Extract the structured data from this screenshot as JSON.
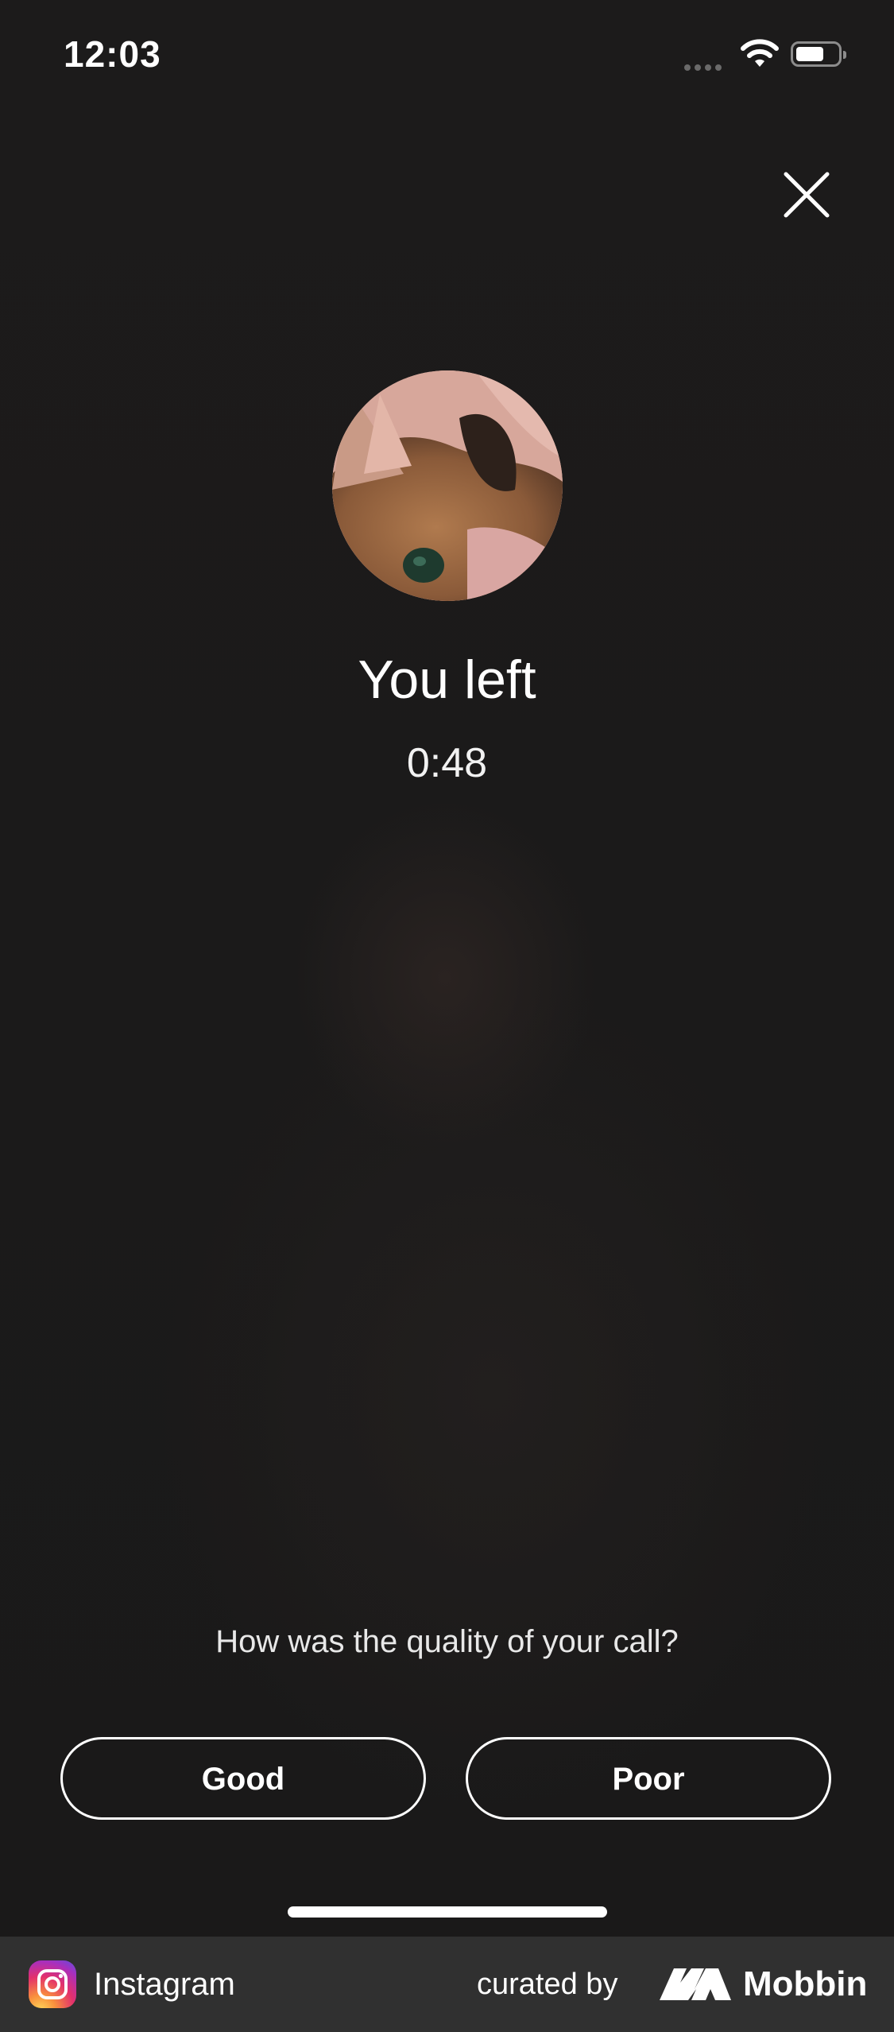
{
  "status_bar": {
    "time": "12:03",
    "icons": [
      "signal-icon",
      "wifi-icon",
      "battery-icon"
    ]
  },
  "call_summary": {
    "title": "You left",
    "duration": "0:48",
    "avatar": "cat-profile-photo"
  },
  "feedback": {
    "question": "How was the quality of your call?",
    "good_label": "Good",
    "poor_label": "Poor"
  },
  "footer": {
    "app_name": "Instagram",
    "curated_by": "curated by",
    "brand": "Mobbin"
  },
  "colors": {
    "background": "#1b1a1a",
    "text": "#ffffff",
    "footer": "#303030",
    "button_border": "#ffffff"
  }
}
